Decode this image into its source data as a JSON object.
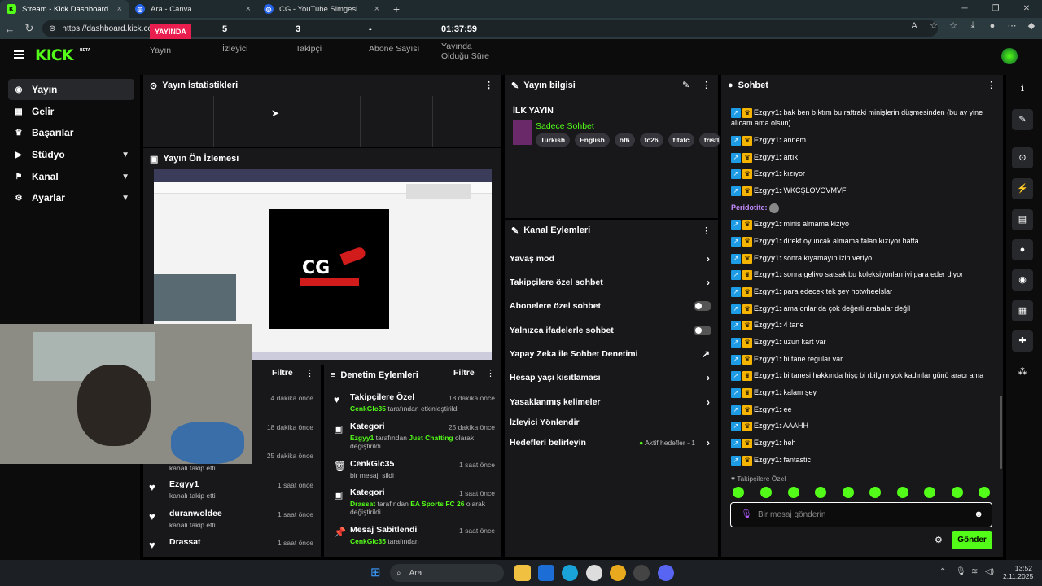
{
  "browser": {
    "tabs": [
      {
        "label": "Stream - Kick Dashboard",
        "active": true
      },
      {
        "label": "Ara - Canva",
        "active": false
      },
      {
        "label": "CG - YouTube Simgesi",
        "active": false
      }
    ],
    "url": "https://dashboard.kick.com/stream"
  },
  "sidebar": {
    "items": [
      {
        "label": "Yayın"
      },
      {
        "label": "Gelir"
      },
      {
        "label": "Başarılar"
      },
      {
        "label": "Stüdyo"
      },
      {
        "label": "Kanal"
      },
      {
        "label": "Ayarlar"
      }
    ]
  },
  "stats": {
    "title": "Yayın İstatistikleri",
    "live_badge": "YAYINDA",
    "live_label": "Yayın",
    "viewers_value": "5",
    "viewers_label": "İzleyici",
    "followers_value": "3",
    "followers_label": "Takipçi",
    "subs_value": "-",
    "subs_label": "Abone Sayısı",
    "duration_value": "01:37:59",
    "duration_label1": "Yayında",
    "duration_label2": "Olduğu Süre"
  },
  "preview": {
    "title": "Yayın Ön İzlemesi",
    "logo_text": "CG"
  },
  "stream_info": {
    "title": "Yayın bilgisi",
    "stream_title": "İLK YAYIN",
    "category": "Sadece Sohbet",
    "tags": [
      "Turkish",
      "English",
      "bf6",
      "fc26",
      "fifafc",
      "fristl"
    ]
  },
  "channel_actions": {
    "title": "Kanal Eylemleri",
    "items": [
      "Yavaş mod",
      "Takipçilere özel sohbet",
      "Abonelere özel sohbet",
      "Yalnızca ifadelerle sohbet",
      "Yapay Zeka ile Sohbet Denetimi",
      "Hesap yaşı kısıtlaması",
      "Yasaklanmış kelimeler",
      "İzleyici Yönlendir",
      "Hedefleri belirleyin"
    ],
    "goals_status": "Aktif hedefler - 1"
  },
  "activity": {
    "filter": "Filtre",
    "rows": [
      {
        "name": "",
        "sub": "",
        "time": "4 dakika önce"
      },
      {
        "name": "",
        "sub": "",
        "time": "18 dakika önce"
      },
      {
        "name": "",
        "sub": "kanalı takip etti",
        "time": "25 dakika önce"
      },
      {
        "name": "Ezgyy1",
        "sub": "kanalı takip etti",
        "time": "1 saat önce"
      },
      {
        "name": "duranwoldee",
        "sub": "kanalı takip etti",
        "time": "1 saat önce"
      },
      {
        "name": "Drassat",
        "sub": "",
        "time": "1 saat önce"
      }
    ]
  },
  "moderation": {
    "title": "Denetim Eylemleri",
    "filter": "Filtre",
    "rows": [
      {
        "name": "Takipçilere Özel",
        "time": "18 dakika önce",
        "line1_user": "CenkGlc35",
        "line1_rest": " tarafından etkinleştirildi",
        "line2": ""
      },
      {
        "name": "Kategori",
        "time": "25 dakika önce",
        "line1_user": "Ezgyy1",
        "line1_rest": " tarafından ",
        "line1_cat": "Just Chatting",
        "line1_end": " olarak",
        "line2": "değiştirildi"
      },
      {
        "name": "CenkGlc35",
        "time": "1 saat önce",
        "line1_user": "",
        "line1_rest": "bir mesajı sildi",
        "line2": ""
      },
      {
        "name": "Kategori",
        "time": "1 saat önce",
        "line1_user": "Drassat",
        "line1_rest": " tarafından ",
        "line1_cat": "EA Sports FC 26",
        "line1_end": " olarak",
        "line2": "değiştirildi"
      },
      {
        "name": "Mesaj Sabitlendi",
        "time": "1 saat önce",
        "line1_user": "CenkGlc35",
        "line1_rest": " tarafından",
        "line2": ""
      }
    ]
  },
  "chat": {
    "title": "Sohbet",
    "messages": [
      {
        "user": "Ezgyy1:",
        "text": "bak ben bıktım bu raftraki minişlerin düşmesinden (bu ay yine alıcam ama olsun)"
      },
      {
        "user": "Ezgyy1:",
        "text": "annem"
      },
      {
        "user": "Ezgyy1:",
        "text": "artık"
      },
      {
        "user": "Ezgyy1:",
        "text": "kızıyor"
      },
      {
        "user": "Ezgyy1:",
        "text": "WKCŞLOVOVMVF"
      },
      {
        "user": "Peridotite:",
        "text": ""
      },
      {
        "user": "Ezgyy1:",
        "text": "minis almama kiziyo"
      },
      {
        "user": "Ezgyy1:",
        "text": "direkt oyuncak almama falan kızıyor hatta"
      },
      {
        "user": "Ezgyy1:",
        "text": "sonra kıyamayıp izin veriyo"
      },
      {
        "user": "Ezgyy1:",
        "text": "sonra geliyo satsak bu koleksiyonları iyi para eder diyor"
      },
      {
        "user": "Ezgyy1:",
        "text": "para edecek tek şey hotwheelslar"
      },
      {
        "user": "Ezgyy1:",
        "text": "ama onlar da çok değerli arabalar değil"
      },
      {
        "user": "Ezgyy1:",
        "text": "4 tane"
      },
      {
        "user": "Ezgyy1:",
        "text": "uzun kart var"
      },
      {
        "user": "Ezgyy1:",
        "text": "bi tane regular var"
      },
      {
        "user": "Ezgyy1:",
        "text": "bi tanesi hakkında hişç bi rbilgim yok kadınlar günü aracı ama"
      },
      {
        "user": "Ezgyy1:",
        "text": "kalanı şey"
      },
      {
        "user": "Ezgyy1:",
        "text": "ee"
      },
      {
        "user": "Ezgyy1:",
        "text": "AAAHH"
      },
      {
        "user": "Ezgyy1:",
        "text": "heh"
      },
      {
        "user": "Ezgyy1:",
        "text": "fantastic"
      }
    ],
    "followers_only": "Takipçilere Özel",
    "input_placeholder": "Bir mesaj gönderin",
    "send_label": "Gönder"
  },
  "taskbar": {
    "search": "Ara",
    "time": "13:52",
    "date": "2.11.2025"
  }
}
